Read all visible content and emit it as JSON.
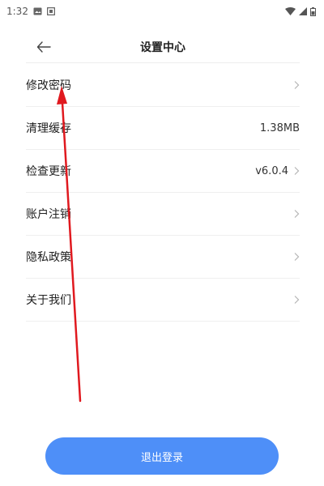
{
  "status_bar": {
    "time": "1:32",
    "icons": [
      "image-icon",
      "notification-icon",
      "wifi-icon",
      "signal-icon",
      "battery-icon"
    ]
  },
  "header": {
    "title": "设置中心",
    "back_icon": "back-arrow-icon"
  },
  "settings": {
    "items": [
      {
        "label": "修改密码",
        "value": "",
        "chevron": true
      },
      {
        "label": "清理缓存",
        "value": "1.38MB",
        "chevron": false
      },
      {
        "label": "检查更新",
        "value": "v6.0.4",
        "chevron": true
      },
      {
        "label": "账户注销",
        "value": "",
        "chevron": true
      },
      {
        "label": "隐私政策",
        "value": "",
        "chevron": true
      },
      {
        "label": "关于我们",
        "value": "",
        "chevron": true
      }
    ]
  },
  "logout": {
    "label": "退出登录"
  },
  "colors": {
    "accent": "#4e8ff8",
    "annotation": "#e0191f",
    "divider": "#efefef"
  }
}
